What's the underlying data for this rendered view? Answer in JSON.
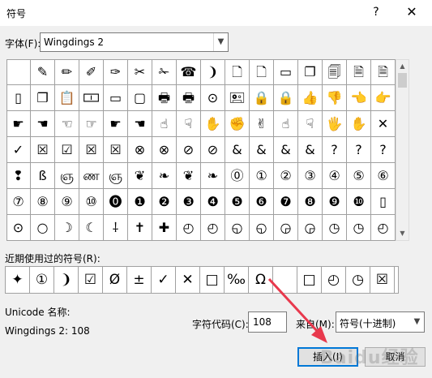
{
  "window": {
    "title": "符号",
    "help_label": "?",
    "close_label": "✕"
  },
  "font": {
    "label": "字体(F):",
    "value": "Wingdings 2"
  },
  "grid": {
    "selected": "3",
    "rows": [
      [
        "",
        "✎",
        "✏",
        "✐",
        "✑",
        "✂",
        "✁",
        "☎",
        "❩",
        "🗋",
        "🗋",
        "▭",
        "❐",
        "🗐",
        "🗎",
        "🗎"
      ],
      [
        "▯",
        "❐",
        "📋",
        "🀱",
        "▭",
        "▢",
        "🖶",
        "🖶",
        "⊙",
        "🖭",
        "🔒",
        "🔒",
        "👍",
        "👎",
        "👈",
        "👉"
      ],
      [
        "☛",
        "☚",
        "☜",
        "☞",
        "☛",
        "☚",
        "☝",
        "☟",
        "✋",
        "✊",
        "✌",
        "☝",
        "☟",
        "🖐",
        "✋",
        "✕"
      ],
      [
        "✓",
        "☒",
        "☑",
        "☒",
        "☒",
        "⊗",
        "⊗",
        "⊘",
        "⊘",
        "&",
        "&",
        "&",
        "&",
        "?",
        "?",
        "?"
      ],
      [
        "❢",
        "ß",
        "ஞ",
        "ண",
        "ஞ",
        "❦",
        "❧",
        "❦",
        "❧",
        "⓪",
        "①",
        "②",
        "③",
        "④",
        "⑤",
        "⑥"
      ],
      [
        "⑦",
        "⑧",
        "⑨",
        "⑩",
        "⓿",
        "❶",
        "❷",
        "❸",
        "❹",
        "❺",
        "❻",
        "❼",
        "❽",
        "❾",
        "❿",
        "▯"
      ],
      [
        "⊙",
        "○",
        "☽",
        "☾",
        "⸸",
        "✝",
        "✚",
        "◴",
        "◴",
        "◵",
        "◵",
        "◶",
        "◶",
        "◷",
        "◷",
        "◴"
      ]
    ]
  },
  "recent": {
    "label": "近期使用过的符号(R):",
    "symbols": [
      "✦",
      "①",
      "❩",
      "☑",
      "Ø",
      "±",
      "✓",
      "✕",
      "□",
      "‰",
      "Ω",
      "",
      "□",
      "◴",
      "◷",
      "☒"
    ]
  },
  "unicode": {
    "label": "Unicode 名称:",
    "description": "Wingdings 2: 108"
  },
  "charcode": {
    "label": "字符代码(C):",
    "value": "108"
  },
  "from": {
    "label": "来自(M):",
    "value": "符号(十进制)"
  },
  "buttons": {
    "insert": "插入(I)",
    "cancel": "取消"
  },
  "watermark": "Baidu经验",
  "colors": {
    "selection": "#0078d7",
    "arrow": "#e8394d"
  }
}
